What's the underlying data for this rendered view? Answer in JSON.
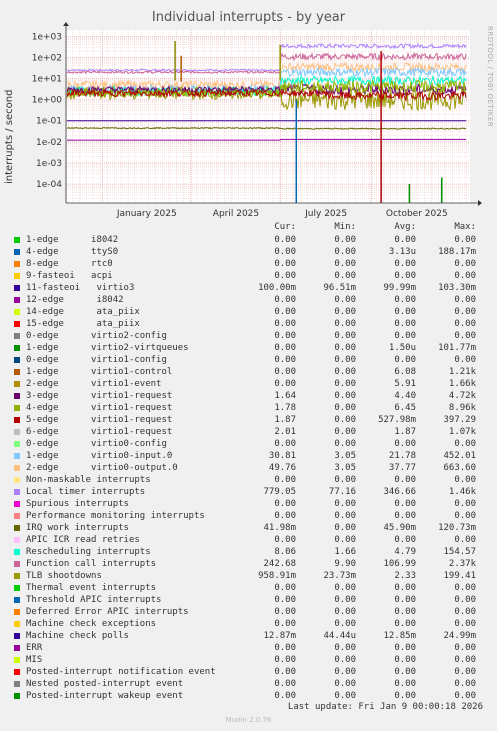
{
  "chart_data": {
    "type": "line",
    "title": "Individual interrupts - by year",
    "ylabel": "interrupts / second",
    "y_scale": "log",
    "ylim": [
      1e-05,
      2000
    ],
    "y_ticks": [
      "1e+03",
      "1e+02",
      "1e+01",
      "1e+00",
      "1e-01",
      "1e-02",
      "1e-03",
      "1e-04"
    ],
    "x_ticks": [
      "January 2025",
      "April 2025",
      "July 2025",
      "October 2025"
    ],
    "x_range": [
      "2024-11-25",
      "2026-01-09"
    ],
    "grid": true,
    "legend_columns": [
      "Cur:",
      "Min:",
      "Avg:",
      "Max:"
    ],
    "series": [
      {
        "name": "1-edge      i8042",
        "color": "#00cc00",
        "cur": "0.00",
        "min": "0.00",
        "avg": "0.00",
        "max": "0.00"
      },
      {
        "name": "4-edge      ttyS0",
        "color": "#0066b3",
        "cur": "0.00",
        "min": "0.00",
        "avg": "3.13u",
        "max": "188.17m"
      },
      {
        "name": "8-edge      rtc0",
        "color": "#ff8000",
        "cur": "0.00",
        "min": "0.00",
        "avg": "0.00",
        "max": "0.00"
      },
      {
        "name": "9-fasteoi   acpi",
        "color": "#ffcc00",
        "cur": "0.00",
        "min": "0.00",
        "avg": "0.00",
        "max": "0.00"
      },
      {
        "name": "11-fasteoi   virtio3",
        "color": "#330099",
        "cur": "100.00m",
        "min": "96.51m",
        "avg": "99.99m",
        "max": "103.30m"
      },
      {
        "name": "12-edge      i8042",
        "color": "#990099",
        "cur": "0.00",
        "min": "0.00",
        "avg": "0.00",
        "max": "0.00"
      },
      {
        "name": "14-edge      ata_piix",
        "color": "#ccff00",
        "cur": "0.00",
        "min": "0.00",
        "avg": "0.00",
        "max": "0.00"
      },
      {
        "name": "15-edge      ata_piix",
        "color": "#ff0000",
        "cur": "0.00",
        "min": "0.00",
        "avg": "0.00",
        "max": "0.00"
      },
      {
        "name": "0-edge      virtio2-config",
        "color": "#808080",
        "cur": "0.00",
        "min": "0.00",
        "avg": "0.00",
        "max": "0.00"
      },
      {
        "name": "1-edge      virtio2-virtqueues",
        "color": "#008f00",
        "cur": "0.00",
        "min": "0.00",
        "avg": "1.50u",
        "max": "101.77m"
      },
      {
        "name": "0-edge      virtio1-config",
        "color": "#00487d",
        "cur": "0.00",
        "min": "0.00",
        "avg": "0.00",
        "max": "0.00"
      },
      {
        "name": "1-edge      virtio1-control",
        "color": "#b35a00",
        "cur": "0.00",
        "min": "0.00",
        "avg": "6.08",
        "max": "1.21k"
      },
      {
        "name": "2-edge      virtio1-event",
        "color": "#b38f00",
        "cur": "0.00",
        "min": "0.00",
        "avg": "5.91",
        "max": "1.66k"
      },
      {
        "name": "3-edge      virtio1-request",
        "color": "#6b006b",
        "cur": "1.64",
        "min": "0.00",
        "avg": "4.40",
        "max": "4.72k"
      },
      {
        "name": "4-edge      virtio1-request",
        "color": "#8fb300",
        "cur": "1.78",
        "min": "0.00",
        "avg": "6.45",
        "max": "8.96k"
      },
      {
        "name": "5-edge      virtio1-request",
        "color": "#b30000",
        "cur": "1.87",
        "min": "0.00",
        "avg": "527.98m",
        "max": "397.29"
      },
      {
        "name": "6-edge      virtio1-request",
        "color": "#bebebe",
        "cur": "2.01",
        "min": "0.00",
        "avg": "1.87",
        "max": "1.07k"
      },
      {
        "name": "0-edge      virtio0-config",
        "color": "#80ff80",
        "cur": "0.00",
        "min": "0.00",
        "avg": "0.00",
        "max": "0.00"
      },
      {
        "name": "1-edge      virtio0-input.0",
        "color": "#80c9ff",
        "cur": "30.81",
        "min": "3.05",
        "avg": "21.78",
        "max": "452.01"
      },
      {
        "name": "2-edge      virtio0-output.0",
        "color": "#ffc080",
        "cur": "49.76",
        "min": "3.05",
        "avg": "37.77",
        "max": "663.60"
      },
      {
        "name": "Non-maskable interrupts",
        "color": "#ffe680",
        "cur": "0.00",
        "min": "0.00",
        "avg": "0.00",
        "max": "0.00"
      },
      {
        "name": "Local timer interrupts",
        "color": "#aa80ff",
        "cur": "779.05",
        "min": "77.16",
        "avg": "346.66",
        "max": "1.46k"
      },
      {
        "name": "Spurious interrupts",
        "color": "#ee00cc",
        "cur": "0.00",
        "min": "0.00",
        "avg": "0.00",
        "max": "0.00"
      },
      {
        "name": "Performance monitoring interrupts",
        "color": "#ff8080",
        "cur": "0.00",
        "min": "0.00",
        "avg": "0.00",
        "max": "0.00"
      },
      {
        "name": "IRQ work interrupts",
        "color": "#666600",
        "cur": "41.98m",
        "min": "0.00",
        "avg": "45.90m",
        "max": "120.73m"
      },
      {
        "name": "APIC ICR read retries",
        "color": "#ffbfff",
        "cur": "0.00",
        "min": "0.00",
        "avg": "0.00",
        "max": "0.00"
      },
      {
        "name": "Rescheduling interrupts",
        "color": "#00ffcc",
        "cur": "8.06",
        "min": "1.66",
        "avg": "4.79",
        "max": "154.57"
      },
      {
        "name": "Function call interrupts",
        "color": "#cc6699",
        "cur": "242.68",
        "min": "9.90",
        "avg": "106.99",
        "max": "2.37k"
      },
      {
        "name": "TLB shootdowns",
        "color": "#999900",
        "cur": "958.91m",
        "min": "23.73m",
        "avg": "2.33",
        "max": "199.41"
      },
      {
        "name": "Thermal event interrupts",
        "color": "#00cc00",
        "cur": "0.00",
        "min": "0.00",
        "avg": "0.00",
        "max": "0.00"
      },
      {
        "name": "Threshold APIC interrupts",
        "color": "#0066b3",
        "cur": "0.00",
        "min": "0.00",
        "avg": "0.00",
        "max": "0.00"
      },
      {
        "name": "Deferred Error APIC interrupts",
        "color": "#ff8000",
        "cur": "0.00",
        "min": "0.00",
        "avg": "0.00",
        "max": "0.00"
      },
      {
        "name": "Machine check exceptions",
        "color": "#ffcc00",
        "cur": "0.00",
        "min": "0.00",
        "avg": "0.00",
        "max": "0.00"
      },
      {
        "name": "Machine check polls",
        "color": "#330099",
        "cur": "12.87m",
        "min": "44.44u",
        "avg": "12.85m",
        "max": "24.99m"
      },
      {
        "name": "ERR",
        "color": "#990099",
        "cur": "0.00",
        "min": "0.00",
        "avg": "0.00",
        "max": "0.00"
      },
      {
        "name": "MIS",
        "color": "#ccff00",
        "cur": "0.00",
        "min": "0.00",
        "avg": "0.00",
        "max": "0.00"
      },
      {
        "name": "Posted-interrupt notification event",
        "color": "#ff0000",
        "cur": "0.00",
        "min": "0.00",
        "avg": "0.00",
        "max": "0.00"
      },
      {
        "name": "Nested posted-interrupt event",
        "color": "#808080",
        "cur": "0.00",
        "min": "0.00",
        "avg": "0.00",
        "max": "0.00"
      },
      {
        "name": "Posted-interrupt wakeup event",
        "color": "#008f00",
        "cur": "0.00",
        "min": "0.00",
        "avg": "0.00",
        "max": "0.00"
      }
    ]
  },
  "watermark": "RRDTOOL / TOBI OETIKER",
  "last_update": "Last update: Fri Jan  9 00:00:18 2026",
  "version": "Munin 2.0.76"
}
